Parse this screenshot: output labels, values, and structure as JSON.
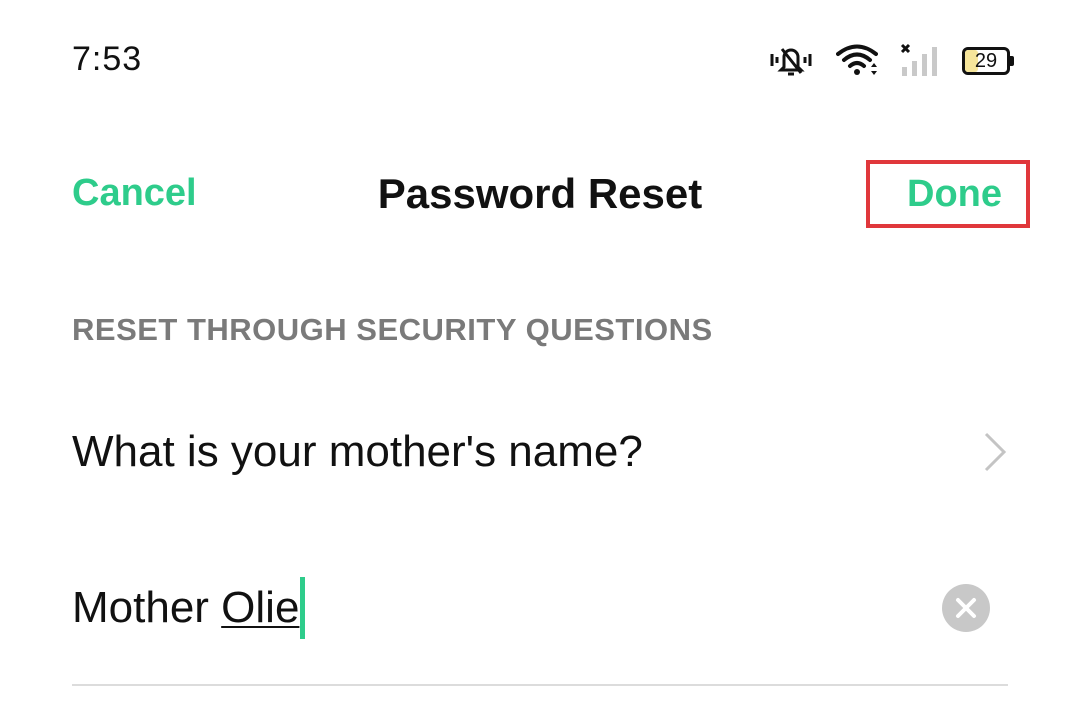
{
  "status_bar": {
    "time": "7:53",
    "battery_level": "29",
    "icons": [
      "vibrate-mute-icon",
      "wifi-icon",
      "cellular-signal-no-service-icon",
      "battery-icon"
    ]
  },
  "nav": {
    "cancel_label": "Cancel",
    "title": "Password Reset",
    "done_label": "Done"
  },
  "section": {
    "header": "RESET THROUGH SECURITY QUESTIONS"
  },
  "question": {
    "text": "What is your mother's name?",
    "icon": "chevron-right-icon"
  },
  "answer": {
    "committed_text": "Mother ",
    "composing_text": "Olie",
    "clear_icon": "clear-icon"
  },
  "colors": {
    "accent": "#2ecc8b",
    "highlight_box": "#e0373b",
    "section_header": "#7a7a7a"
  }
}
